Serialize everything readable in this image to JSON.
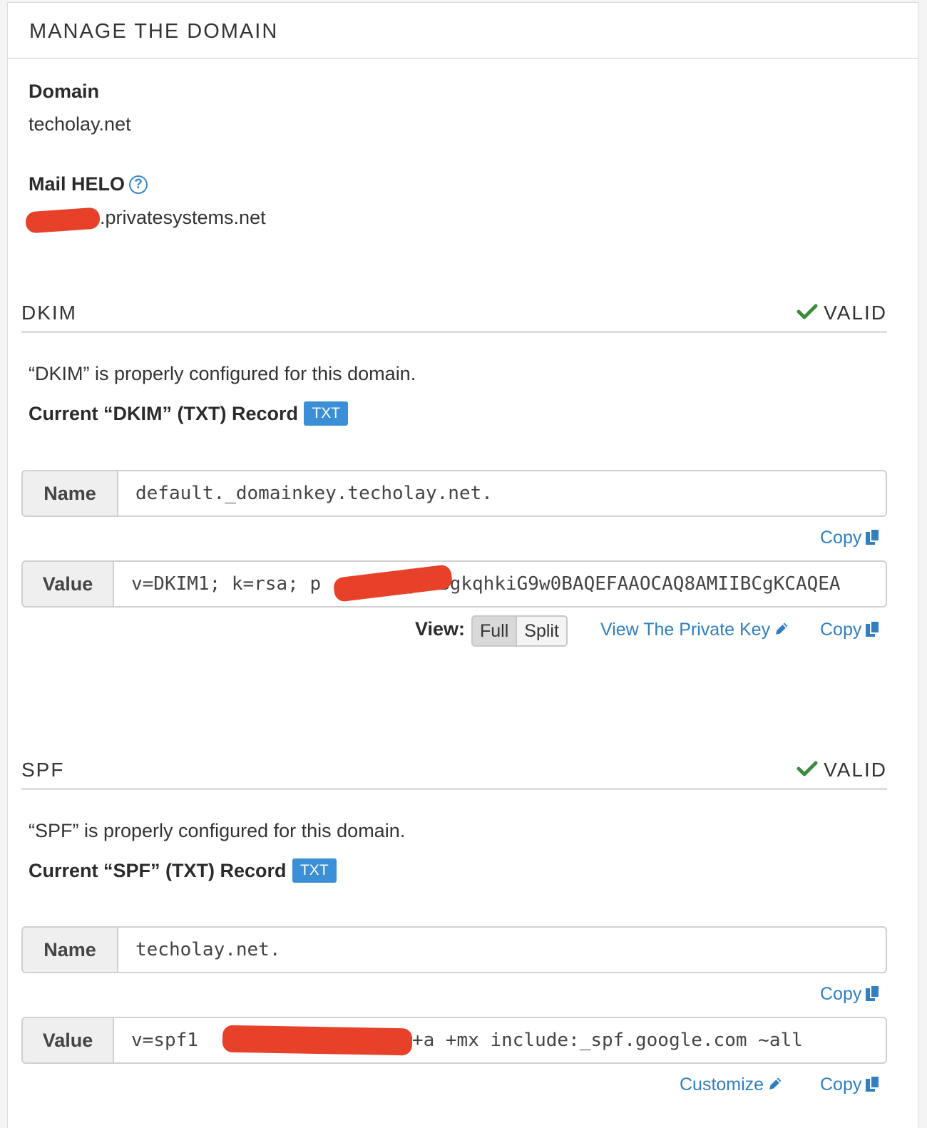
{
  "header": {
    "title": "MANAGE THE DOMAIN"
  },
  "domain": {
    "label": "Domain",
    "value": "techolay.net"
  },
  "helo": {
    "label": "Mail HELO",
    "help_icon": "question-circle-icon",
    "value_suffix": ".privatesystems.net"
  },
  "dkim": {
    "title": "DKIM",
    "status": "VALID",
    "status_icon": "check-icon",
    "status_color": "#3d8b3d",
    "description": "“DKIM” is properly configured for this domain.",
    "record_title": "Current “DKIM” (TXT) Record",
    "badge": "TXT",
    "name_label": "Name",
    "name_value": "default._domainkey.techolay.net.",
    "name_copy": "Copy",
    "value_label": "Value",
    "value_prefix": "v=DKIM1; k=rsa; p",
    "value_suffix": "gANBgkqhkiG9w0BAQEFAAOCAQ8AMIIBCgKCAQEA",
    "view_label": "View:",
    "view_options": [
      "Full",
      "Split"
    ],
    "view_selected": "Full",
    "private_key_link": "View The Private Key",
    "value_copy": "Copy"
  },
  "spf": {
    "title": "SPF",
    "status": "VALID",
    "status_icon": "check-icon",
    "description": "“SPF” is properly configured for this domain.",
    "record_title": "Current “SPF” (TXT) Record",
    "badge": "TXT",
    "name_label": "Name",
    "name_value": "techolay.net.",
    "name_copy": "Copy",
    "value_label": "Value",
    "value_prefix": "v=spf1",
    "value_suffix": "+a +mx include:_spf.google.com ~all",
    "customize_link": "Customize",
    "value_copy": "Copy"
  },
  "colors": {
    "link": "#2f7fc1",
    "badge": "#3a8fd6",
    "redaction": "#e8412a"
  }
}
